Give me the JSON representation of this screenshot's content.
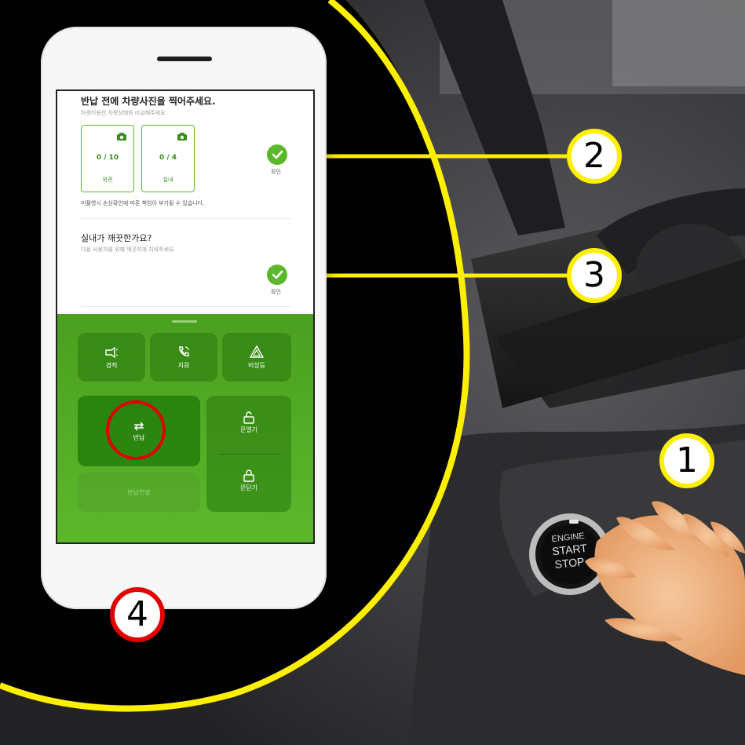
{
  "colors": {
    "accent": "#5cb82b",
    "callout_yellow": "#ffef00",
    "callout_red": "#e00000"
  },
  "photo_section": {
    "title": "반납 전에 차량사진을 찍어주세요.",
    "subtitle": "차량이용전 차량상태와 비교해주세요.",
    "cards": [
      {
        "count": "0 / 10",
        "label": "외관",
        "icon": "camera-icon"
      },
      {
        "count": "0 / 4",
        "label": "실내",
        "icon": "camera-icon"
      }
    ],
    "confirm": "확인",
    "note": "미촬영시 손상확인에 따른 책임이 부가될 수 있습니다."
  },
  "clean_section": {
    "title": "실내가 깨끗한가요?",
    "subtitle": "다음 사용자를 위해 깨끗하게 치워주세요.",
    "confirm": "확인"
  },
  "controls": {
    "horn": {
      "label": "경적",
      "icon": "horn-icon"
    },
    "support": {
      "label": "지원",
      "icon": "phone-icon"
    },
    "hazard": {
      "label": "비상등",
      "icon": "hazard-icon"
    },
    "return": {
      "label": "반납",
      "icon": "return-icon"
    },
    "unlock": {
      "label": "문열기",
      "icon": "unlock-icon"
    },
    "lock": {
      "label": "문닫기",
      "icon": "lock-icon"
    },
    "extend": {
      "label": "반납연장"
    }
  },
  "ignition": {
    "line1": "ENGINE",
    "line2": "START",
    "line3": "STOP"
  },
  "callouts": {
    "c1": "1",
    "c2": "2",
    "c3": "3",
    "c4": "4"
  }
}
